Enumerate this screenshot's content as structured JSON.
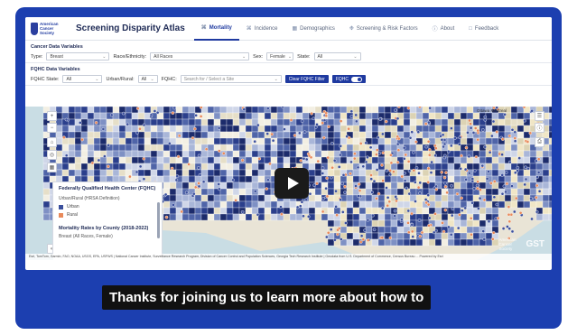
{
  "app": {
    "logo_text": "American Cancer Society",
    "title": "Screening Disparity Atlas"
  },
  "nav": {
    "items": [
      {
        "label": "Mortality",
        "icon": "chart-icon",
        "active": true
      },
      {
        "label": "Incidence",
        "icon": "chart-icon"
      },
      {
        "label": "Demographics",
        "icon": "table-icon"
      },
      {
        "label": "Screening & Risk Factors",
        "icon": "stethoscope-icon"
      },
      {
        "label": "About",
        "icon": "info-icon"
      },
      {
        "label": "Feedback",
        "icon": "feedback-icon"
      }
    ]
  },
  "cancer_vars": {
    "heading": "Cancer Data Variables",
    "type_label": "Type:",
    "type_value": "Breast",
    "race_label": "Race/Ethnicity:",
    "race_value": "All Races",
    "sex_label": "Sex:",
    "sex_value": "Female",
    "state_label": "State:",
    "state_value": "All"
  },
  "fqhc_vars": {
    "heading": "FQHC Data Variables",
    "state_label": "FQHC State:",
    "state_value": "All",
    "urban_label": "Urban/Rural:",
    "urban_value": "All",
    "fqhc_label": "FQHC:",
    "fqhc_placeholder": "Search for / Select a Site",
    "clear_label": "Clear FQHC Filter",
    "toggle_label": "FQHC"
  },
  "map": {
    "city_label": "Ottawa Montreal",
    "legend": {
      "title": "Federally Qualified Health Center (FQHC)",
      "subtitle": "Urban/Rural (HRSA Definition)",
      "items": [
        {
          "label": "Urban",
          "color": "#3b4f9c"
        },
        {
          "label": "Rural",
          "color": "#e8895a"
        }
      ],
      "title2": "Mortality Rates by County (2018-2022)",
      "subtitle2": "Breast (All Races, Female)"
    },
    "brand_acs": "American Cancer Society",
    "brand_gst": "GST",
    "attribution": "Esri, TomTom, Garmin, FAO, NOAA, USGS, EPA, USFWS | National Cancer Institute, Surveillance Research Program, Division of Cancer Control and Population Sciences, Georgia Tech Research Institute | Geodata from U.S. Department of Commerce, Census Bureau ... Powered by Esri"
  },
  "video": {
    "caption": "Thanks for joining us to learn more about how to"
  },
  "colors": {
    "frame": "#1c3fb0",
    "accent": "#1f3aa0",
    "urban": "#3b4f9c",
    "rural": "#e8895a"
  }
}
